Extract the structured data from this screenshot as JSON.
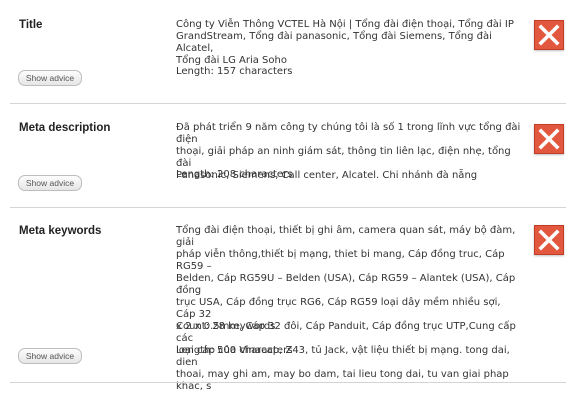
{
  "rows": [
    {
      "label": "Title",
      "text": "Công ty Viễn Thông VCTEL Hà Nội | Tổng đài điện thoại, Tổng đài IP\nGrandStream, Tổng đài panasonic, Tổng đài Siemens, Tổng đài Alcatel,\nTổng đài LG Aria Soho",
      "length": "Length: 157 characters",
      "advice": "Show advice"
    },
    {
      "label": "Meta description",
      "text": "Đã phát triển 9 năm công ty chúng tôi là số 1 trong lĩnh vực tổng đài điện\nthoại, giải pháp an ninh giám sát, thông tin liên lạc, điện nhẹ, tổng đài\nPanasonic, Siemens, Call center, Alcatel. Chi nhánh đà nẵng",
      "length": "Length: 208 characters",
      "advice": "Show advice"
    },
    {
      "label": "Meta keywords",
      "text": "Tổng đài điện thoại, thiết bị ghi âm, camera quan sát, máy bộ đàm, giải\npháp viễn thông,thiết bị mạng, thiet bi mang, Cáp đồng truc, Cáp RG59 –\nBelden, Cáp RG59U – Belden (USA), Cáp RG59 – Alantek (USA), Cáp đồng\ntrục USA, Cáp đồng trục RG6, Cáp RG59 loại dây mềm nhiều sợi, Cáp 32\nx 2 x 0.5mm, Cáp 32 đôi, Cáp Panduit, Cáp đồng trục UTP,Cung cấp các\nloại cáp của Vinacap, Z43, tủ Jack, vật liệu thiết bị mạng. tong dai, dien\nthoai, may ghi am, may bo dam, tai lieu tong dai, tu van giai phap khac, s",
      "count": "Count: 28 keywords",
      "length": "Length: 500 characters",
      "advice": "Show advice"
    }
  ],
  "colors": {
    "fail_icon": "#e2583e",
    "divider": "#d4d4d4"
  },
  "icons": {
    "status": "x-fail-icon"
  }
}
